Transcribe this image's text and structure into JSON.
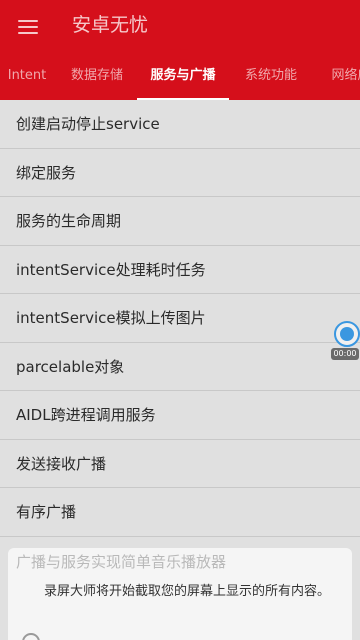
{
  "app_bar": {
    "title": "安卓无忧"
  },
  "tabs": [
    {
      "label": "Intent"
    },
    {
      "label": "数据存储"
    },
    {
      "label": "服务与广播"
    },
    {
      "label": "系统功能"
    },
    {
      "label": "网络应"
    }
  ],
  "active_tab": "服务与广播",
  "list": {
    "items": [
      {
        "label": "创建启动停止service"
      },
      {
        "label": "绑定服务"
      },
      {
        "label": "服务的生命周期"
      },
      {
        "label": "intentService处理耗时任务"
      },
      {
        "label": "intentService模拟上传图片"
      },
      {
        "label": "parcelable对象"
      },
      {
        "label": "AIDL跨进程调用服务"
      },
      {
        "label": "发送接收广播"
      },
      {
        "label": "有序广播"
      }
    ],
    "last_item_label": "广播与服务实现简单音乐播放器"
  },
  "floating_recorder": {
    "time": "00:00"
  },
  "dialog": {
    "message": "录屏大师将开始截取您的屏幕上显示的所有内容。"
  },
  "colors": {
    "accent": "#d50f1b",
    "indicator": "#ffffff",
    "recorder": "#3a97e0"
  }
}
